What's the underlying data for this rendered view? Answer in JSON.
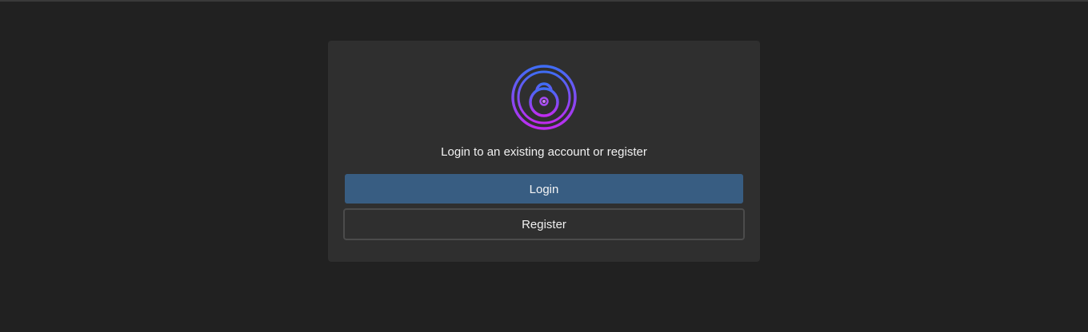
{
  "login_card": {
    "icon": "lock-icon",
    "prompt": "Login to an existing account or register",
    "login_label": "Login",
    "register_label": "Register"
  },
  "colors": {
    "background": "#212121",
    "card": "#2f2f2f",
    "login_button": "#385d82",
    "register_border": "#4b4b4b",
    "icon_gradient_top": "#3f6df5",
    "icon_gradient_bottom": "#c02cf0"
  }
}
